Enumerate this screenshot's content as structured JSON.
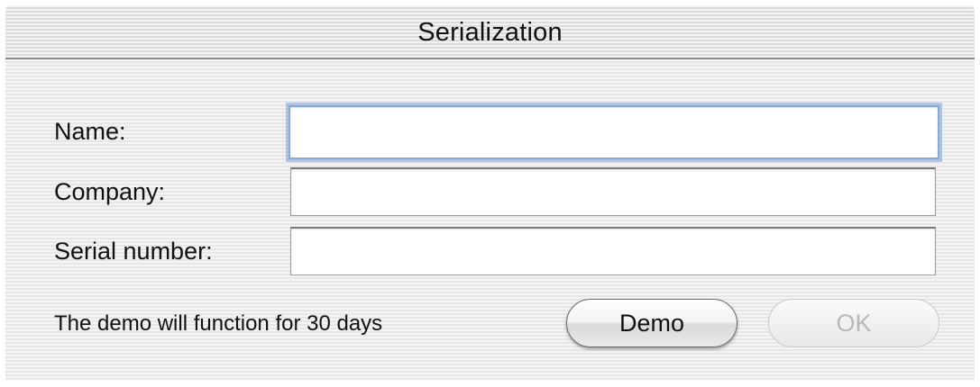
{
  "window": {
    "title": "Serialization"
  },
  "form": {
    "name_label": "Name:",
    "name_value": "",
    "company_label": "Company:",
    "company_value": "",
    "serial_label": "Serial number:",
    "serial_value": ""
  },
  "footer": {
    "note": "The demo will function for 30 days",
    "demo_button": "Demo",
    "ok_button": "OK",
    "ok_enabled": false
  },
  "colors": {
    "focus_ring": "#88a9d4",
    "disabled_text": "#b8b8b8"
  }
}
